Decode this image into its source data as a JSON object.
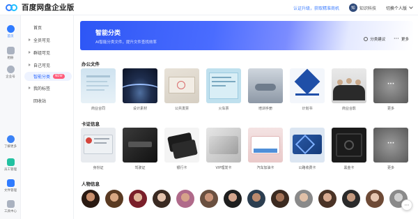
{
  "app": {
    "title": "百度网盘企业版"
  },
  "header": {
    "upgrade_link": "认证升级，获取精准商机",
    "avatar_initial": "知",
    "user_name": "知识科技",
    "switch_label": "切换个人版"
  },
  "rail": [
    {
      "label": "首页",
      "icon": "home-icon",
      "color": "#2f7bff",
      "active": true
    },
    {
      "label": "相册",
      "icon": "album-icon",
      "color": "#9aa3b2",
      "active": false
    },
    {
      "label": "企业号",
      "icon": "enterprise-icon",
      "color": "#9aa3b2",
      "active": false
    },
    {
      "label": "了解更多",
      "icon": "more-info-icon",
      "color": "#3b82f6",
      "active": false
    },
    {
      "label": "员工管理",
      "icon": "staff-icon",
      "color": "#22c1a1",
      "active": false
    },
    {
      "label": "文件管理",
      "icon": "file-manage-icon",
      "color": "#2f7bff",
      "active": false
    },
    {
      "label": "工具中心",
      "icon": "tools-icon",
      "color": "#9aa3b2",
      "active": false
    }
  ],
  "nav": {
    "items": [
      {
        "label": "首页",
        "caret": false,
        "active": false
      },
      {
        "label": "全员可见",
        "caret": true,
        "active": false
      },
      {
        "label": "群组可见",
        "caret": true,
        "active": false
      },
      {
        "label": "自己可见",
        "caret": true,
        "active": false
      },
      {
        "label": "智能分类",
        "caret": false,
        "active": true,
        "badge": "NEW"
      },
      {
        "label": "我的标签",
        "caret": true,
        "active": false
      },
      {
        "label": "回收站",
        "caret": false,
        "active": false
      }
    ]
  },
  "banner": {
    "title": "智能分类",
    "subtitle": "AI智能分类文件，提升文件查找效率",
    "suggest_label": "分类建议",
    "more_label": "更多"
  },
  "sections": [
    {
      "title": "办公文件",
      "items": [
        "商业合同",
        "设计素材",
        "公共发票",
        "火车票",
        "培训手册",
        "计划书",
        "商业合影",
        "更多"
      ]
    },
    {
      "title": "卡证信息",
      "items": [
        "身份证",
        "驾驶证",
        "银行卡",
        "VIP理发卡",
        "汽车加油卡",
        "公路收费卡",
        "黑金卡",
        "更多"
      ]
    },
    {
      "title": "人物信息",
      "items": []
    }
  ],
  "help_glyph": "⋯"
}
